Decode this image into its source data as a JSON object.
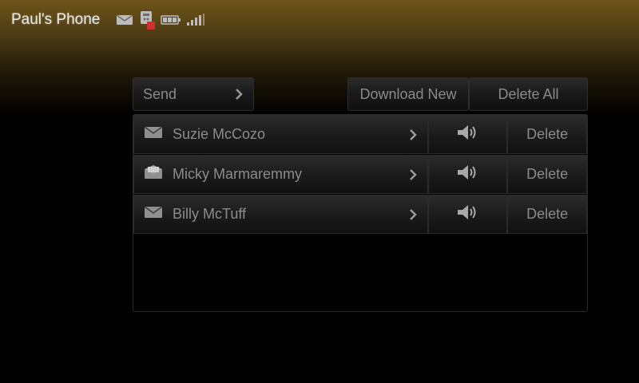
{
  "status": {
    "phone_name": "Paul's Phone",
    "icons": [
      "message-icon",
      "voicemail-alert-icon",
      "battery-icon",
      "signal-icon"
    ]
  },
  "toolbar": {
    "send_label": "Send",
    "download_new_label": "Download New",
    "delete_all_label": "Delete All"
  },
  "messages": [
    {
      "name": "Suzie McCozo",
      "icon": "envelope-closed-icon",
      "delete_label": "Delete"
    },
    {
      "name": "Micky Marmaremmy",
      "icon": "envelope-open-icon",
      "delete_label": "Delete"
    },
    {
      "name": "Billy McTuff",
      "icon": "envelope-closed-icon",
      "delete_label": "Delete"
    }
  ],
  "colors": {
    "header_gold": "#6e5419",
    "background": "#000000",
    "text_gray": "#8a8a8a"
  }
}
